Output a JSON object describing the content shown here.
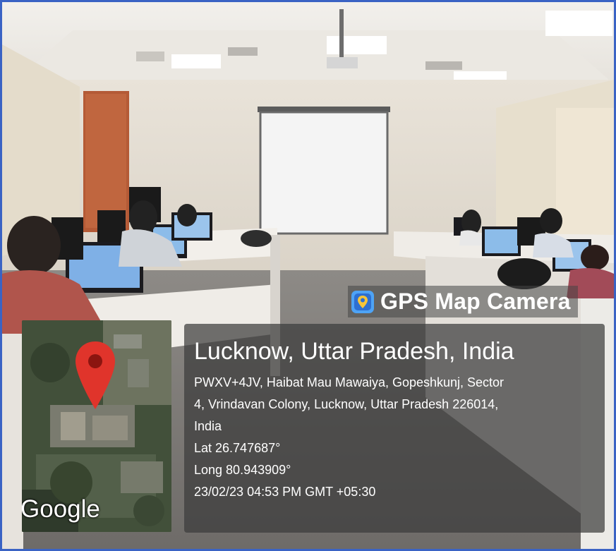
{
  "app_badge": {
    "icon": "map-pin-camera-icon",
    "name": "GPS Map Camera"
  },
  "map": {
    "attribution": "Google",
    "marker_icon": "map-marker-icon"
  },
  "location": {
    "title": "Lucknow, Uttar Pradesh, India",
    "address_line_1": "PWXV+4JV, Haibat Mau Mawaiya, Gopeshkunj, Sector",
    "address_line_2": "4, Vrindavan Colony, Lucknow, Uttar Pradesh 226014,",
    "address_line_3": "India",
    "latitude": "Lat 26.747687°",
    "longitude": "Long 80.943909°",
    "timestamp": "23/02/23 04:53 PM GMT +05:30"
  },
  "colors": {
    "frame_border": "#3a63c4",
    "marker_red": "#e0342b",
    "overlay": "#3c3c3c"
  }
}
